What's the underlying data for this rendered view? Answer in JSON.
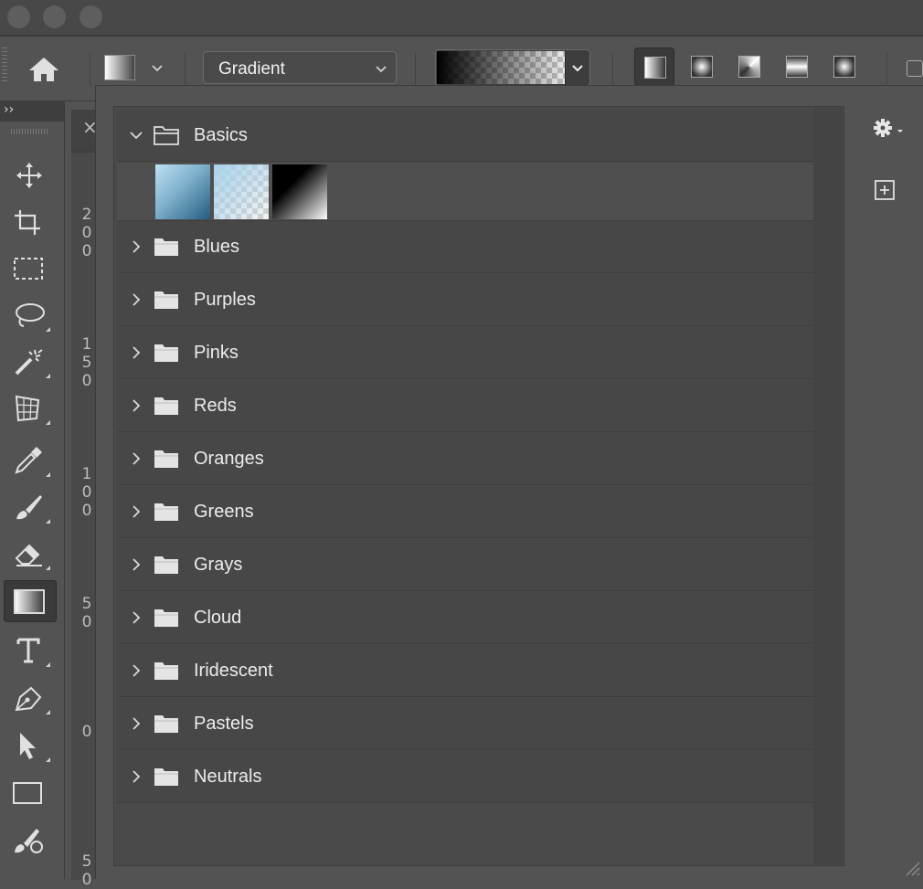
{
  "options_bar": {
    "mode_label": "Gradient",
    "shape_buttons": [
      "linear-gradient",
      "radial-gradient",
      "angle-gradient",
      "reflected-gradient",
      "diamond-gradient"
    ],
    "active_shape": "linear-gradient"
  },
  "document_tab": {
    "close_label": "×"
  },
  "ruler": {
    "ticks": [
      "2\n0\n0",
      "1\n5\n0",
      "1\n0\n0",
      "5\n0",
      "0",
      "5\n0"
    ]
  },
  "toolbar": {
    "expand_label": "››",
    "tools": [
      "move-tool",
      "crop-tool",
      "marquee-tool",
      "lasso-tool",
      "magic-wand-tool",
      "perspective-crop-tool",
      "eyedropper-tool",
      "brush-tool",
      "eraser-tool",
      "gradient-tool",
      "type-tool",
      "pen-tool",
      "path-selection-tool",
      "rectangle-tool",
      "color-replacement-tool"
    ],
    "active_tool": "gradient-tool"
  },
  "gradient_picker": {
    "groups": [
      {
        "name": "Basics",
        "expanded": true
      },
      {
        "name": "Blues",
        "expanded": false
      },
      {
        "name": "Purples",
        "expanded": false
      },
      {
        "name": "Pinks",
        "expanded": false
      },
      {
        "name": "Reds",
        "expanded": false
      },
      {
        "name": "Oranges",
        "expanded": false
      },
      {
        "name": "Greens",
        "expanded": false
      },
      {
        "name": "Grays",
        "expanded": false
      },
      {
        "name": "Cloud",
        "expanded": false
      },
      {
        "name": "Iridescent",
        "expanded": false
      },
      {
        "name": "Pastels",
        "expanded": false
      },
      {
        "name": "Neutrals",
        "expanded": false
      }
    ],
    "basics_swatches": [
      "blue-gradient",
      "light-blue-transparent-gradient",
      "black-white-gradient"
    ]
  },
  "colors": {
    "ui_background": "#535353",
    "list_row": "#474747",
    "text": "#ececec"
  }
}
